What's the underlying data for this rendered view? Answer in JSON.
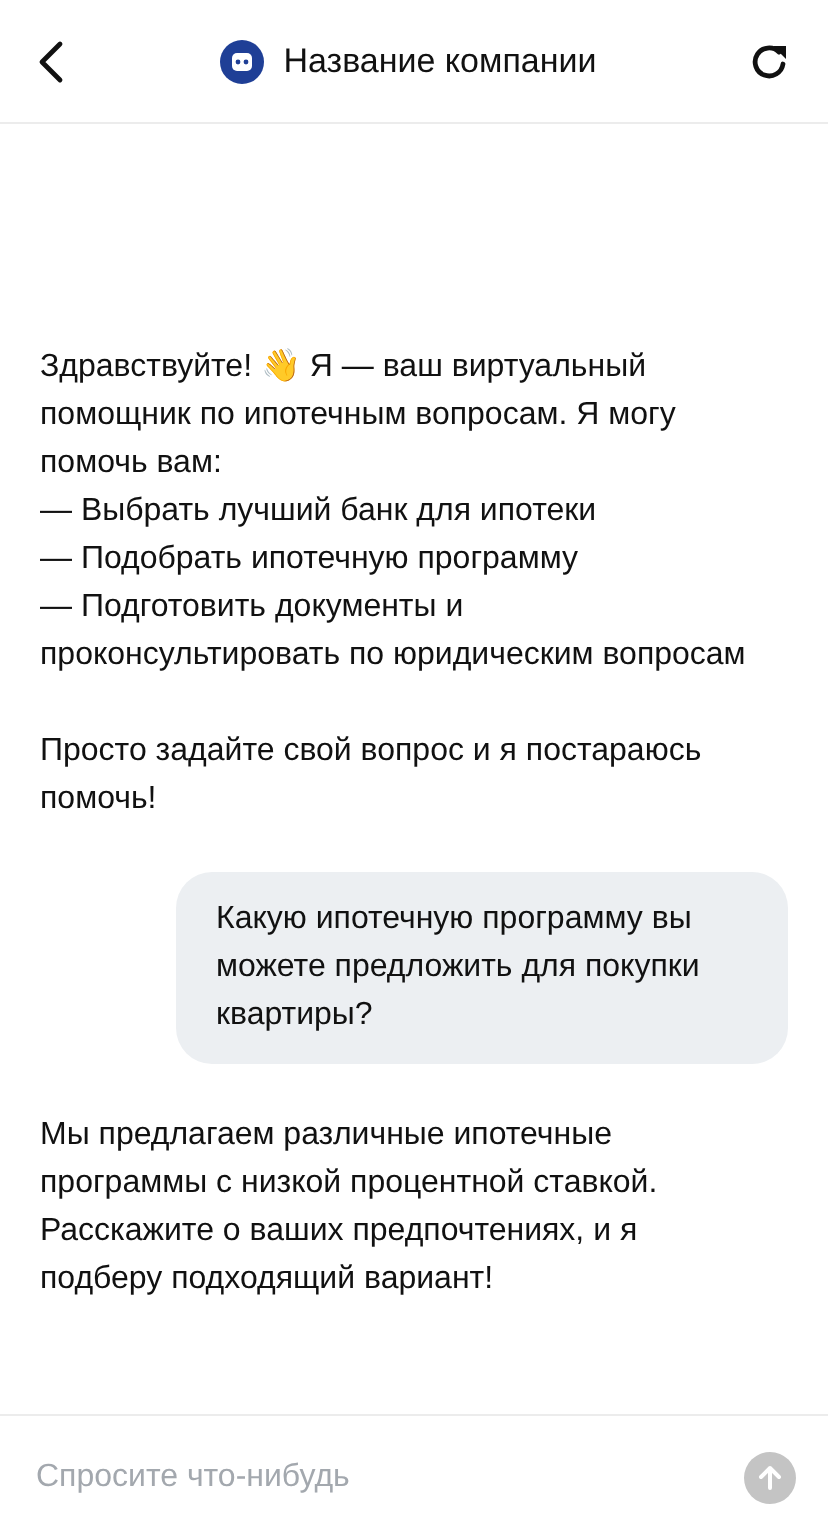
{
  "header": {
    "title": "Название компании"
  },
  "messages": [
    {
      "kind": "bot",
      "intro": "Здравствуйте! 👋 Я — ваш виртуальный помощник по ипотечным вопросам. Я могу помочь вам:",
      "items": [
        "— Выбрать лучший банк для ипотеки",
        "— Подобрать ипотечную программу",
        "— Подготовить документы и проконсультировать по юридическим вопросам"
      ],
      "outro": "Просто задайте свой вопрос и я постараюсь помочь!"
    },
    {
      "kind": "user",
      "text": "Какую ипотечную программу вы можете предложить для покупки квартиры?"
    },
    {
      "kind": "bot",
      "intro": "Мы предлагаем различные ипотечные программы с низкой процентной ставкой. Расскажите о ваших предпочтениях, и я подберу подходящий вариант!"
    }
  ],
  "composer": {
    "placeholder": "Спросите что-нибудь",
    "send_disabled": true
  }
}
